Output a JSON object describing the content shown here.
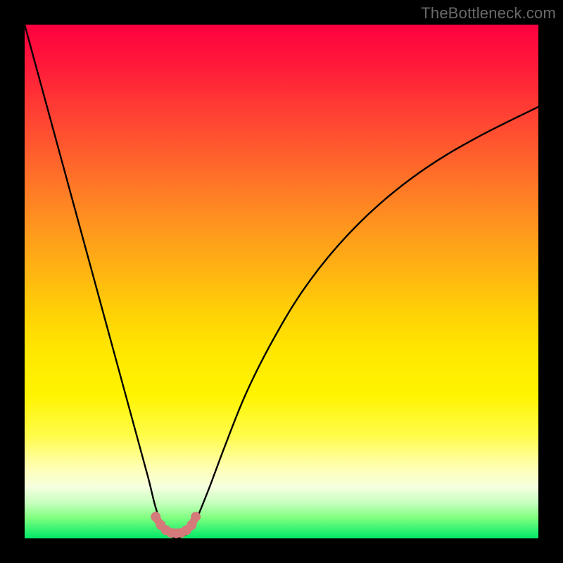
{
  "watermark": "TheBottleneck.com",
  "chart_data": {
    "type": "line",
    "title": "",
    "xlabel": "",
    "ylabel": "",
    "xlim": [
      0,
      100
    ],
    "ylim": [
      0,
      100
    ],
    "series": [
      {
        "name": "bottleneck-curve",
        "x": [
          0,
          3,
          6,
          9,
          12,
          15,
          18,
          21,
          24,
          25.5,
          27,
          28,
          29,
          29.5,
          30,
          31,
          32,
          33,
          34,
          36,
          39,
          43,
          48,
          54,
          61,
          69,
          78,
          88,
          100
        ],
        "y": [
          100,
          89,
          78,
          67,
          56,
          45,
          34,
          23,
          12,
          6,
          1.8,
          0.6,
          0.2,
          0.1,
          0.15,
          0.5,
          1.3,
          2.8,
          5,
          10,
          18,
          28,
          38,
          48,
          57,
          65,
          72,
          78,
          84
        ]
      },
      {
        "name": "optimal-zone-marker",
        "x": [
          25.5,
          26.5,
          27.5,
          28.5,
          29.5,
          30.5,
          31.5,
          32.5,
          33.3
        ],
        "y": [
          4.2,
          2.6,
          1.6,
          1.1,
          1.0,
          1.1,
          1.6,
          2.6,
          4.2
        ]
      }
    ],
    "colors": {
      "curve": "#000000",
      "marker": "#d47a7a",
      "gradient_top": "#ff0040",
      "gradient_bottom": "#00e868"
    }
  }
}
